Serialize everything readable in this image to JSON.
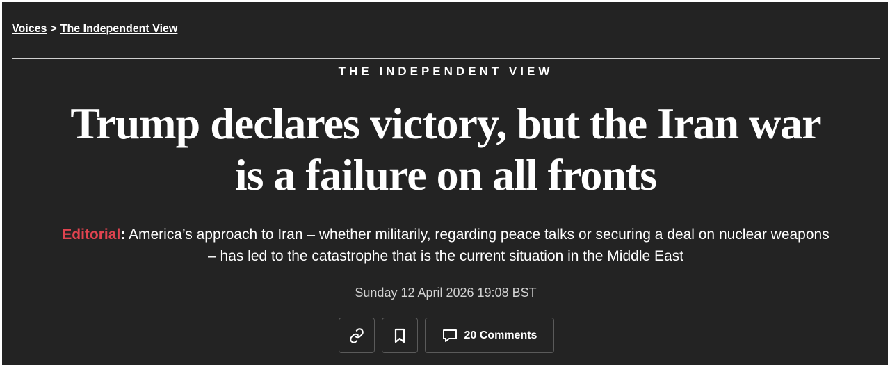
{
  "breadcrumb": {
    "items": [
      "Voices",
      "The Independent View"
    ],
    "separator": ">"
  },
  "section": {
    "label": "THE INDEPENDENT VIEW"
  },
  "article": {
    "headline_line1": "Trump declares victory, but the Iran war",
    "headline_line2": "is a failure on all fronts",
    "standfirst_tag": "Editorial",
    "standfirst_colon": ":",
    "standfirst_line1": " America’s approach to Iran – whether militarily, regarding peace talks or securing a deal on nuclear weapons",
    "standfirst_line2": "– has led to the catastrophe that is the current situation in the Middle East",
    "dateline": "Sunday 12 April 2026 19:08 BST"
  },
  "actions": {
    "copy_link_icon": "link-icon",
    "bookmark_icon": "bookmark-icon",
    "comments_icon": "comment-icon",
    "comments_label": "20 Comments"
  },
  "colors": {
    "background": "#232323",
    "text": "#ffffff",
    "accent": "#e0434f",
    "muted": "#d2d2d2",
    "rule": "#cfcfcf"
  }
}
